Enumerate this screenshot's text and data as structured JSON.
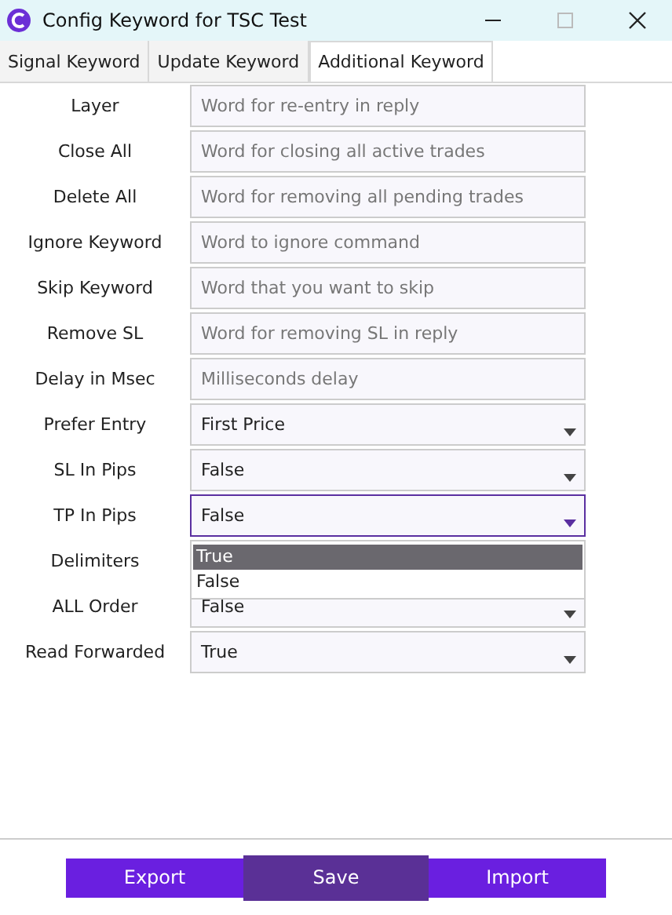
{
  "window": {
    "title": "Config Keyword for TSC Test"
  },
  "tabs": [
    {
      "label": "Signal Keyword",
      "selected": false
    },
    {
      "label": "Update Keyword",
      "selected": false
    },
    {
      "label": "Additional Keyword",
      "selected": true
    }
  ],
  "rows": [
    {
      "label": "Layer",
      "kind": "text",
      "placeholder": "Word for re-entry in reply"
    },
    {
      "label": "Close All",
      "kind": "text",
      "placeholder": "Word for closing all active trades"
    },
    {
      "label": "Delete All",
      "kind": "text",
      "placeholder": "Word for removing all pending trades"
    },
    {
      "label": "Ignore Keyword",
      "kind": "text",
      "placeholder": "Word to ignore command"
    },
    {
      "label": "Skip Keyword",
      "kind": "text",
      "placeholder": "Word that you want to skip"
    },
    {
      "label": "Remove SL",
      "kind": "text",
      "placeholder": "Word for removing SL in reply"
    },
    {
      "label": "Delay in Msec",
      "kind": "text",
      "placeholder": "Milliseconds delay"
    },
    {
      "label": "Prefer Entry",
      "kind": "select",
      "value": "First Price",
      "focused": false
    },
    {
      "label": "SL In Pips",
      "kind": "select",
      "value": "False",
      "focused": false
    },
    {
      "label": "TP In Pips",
      "kind": "select",
      "value": "False",
      "focused": true,
      "options": [
        {
          "label": "True",
          "highlighted": true
        },
        {
          "label": "False",
          "highlighted": false
        }
      ]
    },
    {
      "label": "Delimiters",
      "kind": "hidden"
    },
    {
      "label": "ALL Order",
      "kind": "select",
      "value": "False",
      "focused": false
    },
    {
      "label": "Read Forwarded",
      "kind": "select",
      "value": "True",
      "focused": false
    }
  ],
  "buttons": [
    {
      "label": "Export",
      "selected": false
    },
    {
      "label": "Save",
      "selected": true
    },
    {
      "label": "Import",
      "selected": false
    }
  ]
}
